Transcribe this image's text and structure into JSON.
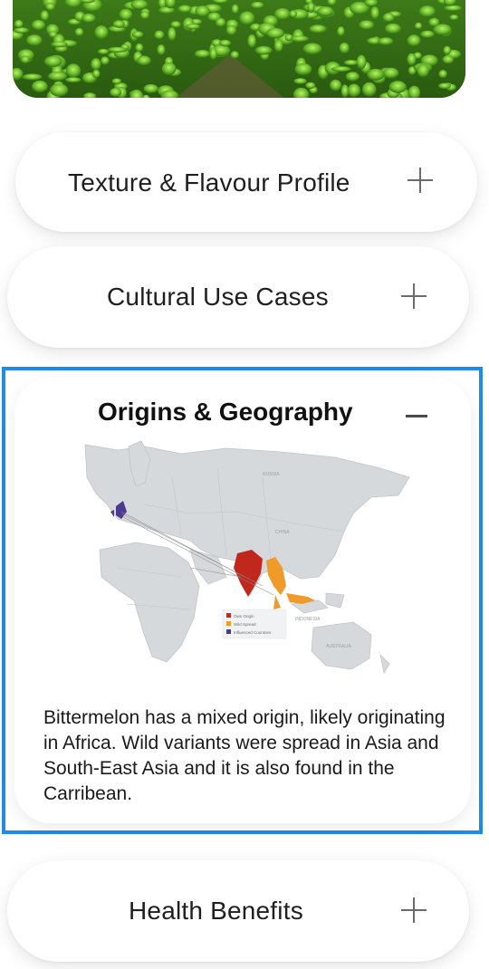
{
  "accordion": {
    "items": [
      {
        "label": "Texture & Flavour Profile",
        "state": "collapsed"
      },
      {
        "label": "Cultural Use Cases",
        "state": "collapsed"
      },
      {
        "label": "Origins & Geography",
        "state": "expanded",
        "body": "Bittermelon has a mixed origin, likely originating in Africa. Wild variants were spread in Asia and South-East Asia and it is also found in the Carribean."
      },
      {
        "label": "Health Benefits",
        "state": "collapsed"
      }
    ]
  },
  "map": {
    "labels": {
      "russia": "RUSSIA",
      "china": "CHINA",
      "indonesia": "INDONESIA",
      "australia": "AUSTRALIA"
    },
    "legend": [
      {
        "label": "Own Origin",
        "color": "#c0281d"
      },
      {
        "label": "Wild Spread",
        "color": "#ef9a29"
      },
      {
        "label": "Influenced Countries",
        "color": "#4c3a8f"
      }
    ]
  },
  "colors": {
    "highlight": "#1e8be6",
    "hero_green": "#4c8f1f"
  }
}
